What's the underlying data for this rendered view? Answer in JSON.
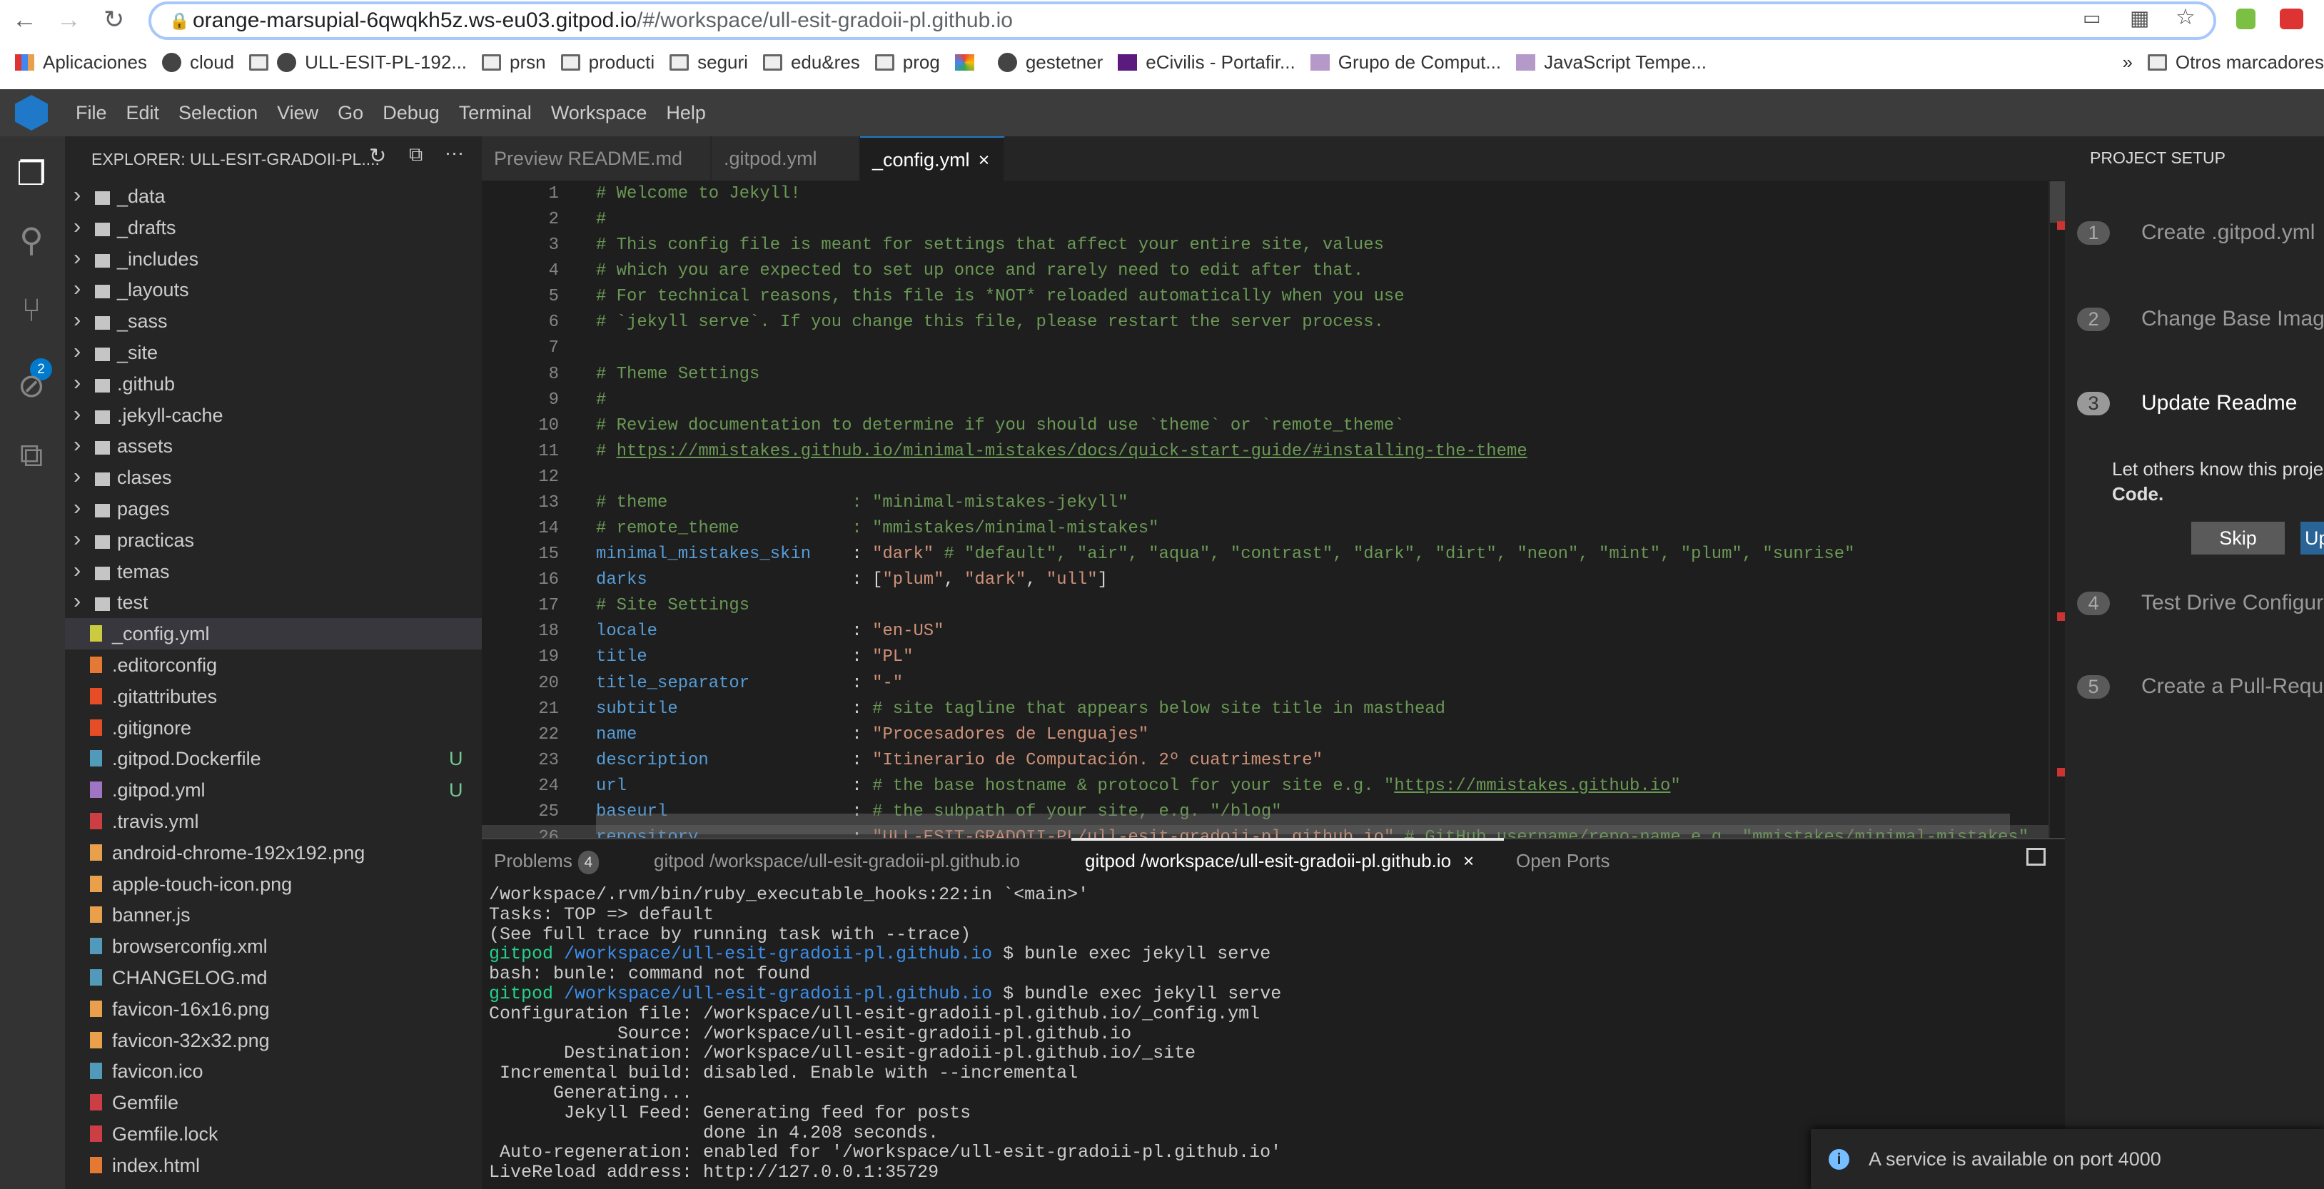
{
  "browser": {
    "url_host": "orange-marsupial-6qwqkh5z.ws-eu03.gitpod.io",
    "url_path": "/#/workspace/ull-esit-gradoii-pl.github.io",
    "bookmarks": [
      "Aplicaciones",
      "cloud",
      "ULL-ESIT-PL-192...",
      "prsn",
      "producti",
      "seguri",
      "edu&res",
      "prog",
      "",
      "gestetner",
      "eCivilis - Portafir...",
      "Grupo de Comput...",
      "JavaScript Tempe..."
    ],
    "bookmark_icons": [
      "apps-icon",
      "globe-icon",
      "folder-icon",
      "github-icon",
      "folder-icon",
      "folder-icon",
      "folder-icon",
      "folder-icon",
      "folder-icon",
      "pinwheel-icon",
      "globe-icon",
      "ecivilis-icon",
      "ull-icon",
      "ull-icon"
    ],
    "more": "»",
    "other_bookmarks": "Otros marcadores"
  },
  "menu": [
    "File",
    "Edit",
    "Selection",
    "View",
    "Go",
    "Debug",
    "Terminal",
    "Workspace",
    "Help"
  ],
  "scm_badge": "2",
  "explorer": {
    "title": "EXPLORER: ULL-ESIT-GRADOII-PL....",
    "items": [
      {
        "n": "_data",
        "f": 1
      },
      {
        "n": "_drafts",
        "f": 1
      },
      {
        "n": "_includes",
        "f": 1
      },
      {
        "n": "_layouts",
        "f": 1
      },
      {
        "n": "_sass",
        "f": 1
      },
      {
        "n": "_site",
        "f": 1
      },
      {
        "n": ".github",
        "f": 1
      },
      {
        "n": ".jekyll-cache",
        "f": 1
      },
      {
        "n": "assets",
        "f": 1
      },
      {
        "n": "clases",
        "f": 1
      },
      {
        "n": "pages",
        "f": 1
      },
      {
        "n": "practicas",
        "f": 1
      },
      {
        "n": "temas",
        "f": 1
      },
      {
        "n": "test",
        "f": 1
      },
      {
        "n": "_config.yml",
        "c": "#cbcb41",
        "sel": 1
      },
      {
        "n": ".editorconfig",
        "c": "#e37933"
      },
      {
        "n": ".gitattributes",
        "c": "#e44d26"
      },
      {
        "n": ".gitignore",
        "c": "#e44d26"
      },
      {
        "n": ".gitpod.Dockerfile",
        "c": "#519aba",
        "g": "U"
      },
      {
        "n": ".gitpod.yml",
        "c": "#a074c4",
        "g": "U"
      },
      {
        "n": ".travis.yml",
        "c": "#cc3e44"
      },
      {
        "n": "android-chrome-192x192.png",
        "c": "#e8a04c"
      },
      {
        "n": "apple-touch-icon.png",
        "c": "#e8a04c"
      },
      {
        "n": "banner.js",
        "c": "#e8a04c"
      },
      {
        "n": "browserconfig.xml",
        "c": "#519aba"
      },
      {
        "n": "CHANGELOG.md",
        "c": "#519aba"
      },
      {
        "n": "favicon-16x16.png",
        "c": "#e8a04c"
      },
      {
        "n": "favicon-32x32.png",
        "c": "#e8a04c"
      },
      {
        "n": "favicon.ico",
        "c": "#519aba"
      },
      {
        "n": "Gemfile",
        "c": "#cc3e44"
      },
      {
        "n": "Gemfile.lock",
        "c": "#cc3e44"
      },
      {
        "n": "index.html",
        "c": "#e37933"
      }
    ]
  },
  "tabs": [
    {
      "label": "Preview README.md"
    },
    {
      "label": ".gitpod.yml"
    },
    {
      "label": "_config.yml",
      "close": "×"
    }
  ],
  "code": [
    [
      [
        "c",
        "# Welcome to Jekyll!"
      ]
    ],
    [
      [
        "c",
        "#"
      ]
    ],
    [
      [
        "c",
        "# This config file is meant for settings that affect your entire site, values"
      ]
    ],
    [
      [
        "c",
        "# which you are expected to set up once and rarely need to edit after that."
      ]
    ],
    [
      [
        "c",
        "# For technical reasons, this file is *NOT* reloaded automatically when you use"
      ]
    ],
    [
      [
        "c",
        "# `jekyll serve`. If you change this file, please restart the server process."
      ]
    ],
    [],
    [
      [
        "c",
        "# Theme Settings"
      ]
    ],
    [
      [
        "c",
        "#"
      ]
    ],
    [
      [
        "c",
        "# Review documentation to determine if you should use `theme` or `remote_theme`"
      ]
    ],
    [
      [
        "c",
        "# "
      ],
      [
        "u",
        "https://mmistakes.github.io/minimal-mistakes/docs/quick-start-guide/#installing-the-theme"
      ]
    ],
    [],
    [
      [
        "c",
        "# theme                  : \"minimal-mistakes-jekyll\""
      ]
    ],
    [
      [
        "c",
        "# remote_theme           : \"mmistakes/minimal-mistakes\""
      ]
    ],
    [
      [
        "k",
        "minimal_mistakes_skin"
      ],
      [
        "p",
        "    : "
      ],
      [
        "s",
        "\"dark\""
      ],
      [
        "c",
        " # \"default\", \"air\", \"aqua\", \"contrast\", \"dark\", \"dirt\", \"neon\", \"mint\", \"plum\", \"sunrise\""
      ]
    ],
    [
      [
        "k",
        "darks"
      ],
      [
        "p",
        "                    : "
      ],
      [
        "p",
        "["
      ],
      [
        "s",
        "\"plum\""
      ],
      [
        "p",
        ", "
      ],
      [
        "s",
        "\"dark\""
      ],
      [
        "p",
        ", "
      ],
      [
        "s",
        "\"ull\""
      ],
      [
        "p",
        "]"
      ]
    ],
    [
      [
        "c",
        "# Site Settings"
      ]
    ],
    [
      [
        "k",
        "locale"
      ],
      [
        "p",
        "                   : "
      ],
      [
        "s",
        "\"en-US\""
      ]
    ],
    [
      [
        "k",
        "title"
      ],
      [
        "p",
        "                    : "
      ],
      [
        "s",
        "\"PL\""
      ]
    ],
    [
      [
        "k",
        "title_separator"
      ],
      [
        "p",
        "          : "
      ],
      [
        "s",
        "\"-\""
      ]
    ],
    [
      [
        "k",
        "subtitle"
      ],
      [
        "p",
        "                 : "
      ],
      [
        "c",
        "# site tagline that appears below site title in masthead"
      ]
    ],
    [
      [
        "k",
        "name"
      ],
      [
        "p",
        "                     : "
      ],
      [
        "s",
        "\"Procesadores de Lenguajes\""
      ]
    ],
    [
      [
        "k",
        "description"
      ],
      [
        "p",
        "              : "
      ],
      [
        "s",
        "\"Itinerario de Computación. 2º cuatrimestre\""
      ]
    ],
    [
      [
        "k",
        "url"
      ],
      [
        "p",
        "                      : "
      ],
      [
        "c",
        "# the base hostname & protocol for your site e.g. \""
      ],
      [
        "u",
        "https://mmistakes.github.io"
      ],
      [
        "c",
        "\""
      ]
    ],
    [
      [
        "k",
        "baseurl"
      ],
      [
        "p",
        "                  : "
      ],
      [
        "c",
        "# the subpath of your site, e.g. \"/blog\""
      ]
    ],
    [
      [
        "k",
        "repository"
      ],
      [
        "p",
        "               : "
      ],
      [
        "s",
        "\"ULL-ESIT-GRADOII-PL/ull-esit-gradoii-pl.github.io\""
      ],
      [
        "c",
        " # GitHub username/repo-name e.g. \"mmistakes/minimal-mistakes\""
      ]
    ]
  ],
  "panel": {
    "problems": "Problems",
    "problems_count": "4",
    "term1": "gitpod /workspace/ull-esit-gradoii-pl.github.io",
    "term2": "gitpod /workspace/ull-esit-gradoii-pl.github.io",
    "term2_close": "×",
    "ports": "Open Ports"
  },
  "terminal": [
    [
      [
        "",
        "/workspace/.rvm/bin/ruby_executable_hooks:22:in `<main>'"
      ]
    ],
    [
      [
        "",
        "Tasks: TOP => default"
      ]
    ],
    [
      [
        "",
        "(See full trace by running task with --trace)"
      ]
    ],
    [
      [
        "tg",
        "gitpod "
      ],
      [
        "tb",
        "/workspace/ull-esit-gradoii-pl.github.io"
      ],
      [
        "",
        " $ bunle exec jekyll serve"
      ]
    ],
    [
      [
        "",
        "bash: bunle: command not found"
      ]
    ],
    [
      [
        "tg",
        "gitpod "
      ],
      [
        "tb",
        "/workspace/ull-esit-gradoii-pl.github.io"
      ],
      [
        "",
        " $ bundle exec jekyll serve"
      ]
    ],
    [
      [
        "",
        "Configuration file: /workspace/ull-esit-gradoii-pl.github.io/_config.yml"
      ]
    ],
    [
      [
        "",
        "            Source: /workspace/ull-esit-gradoii-pl.github.io"
      ]
    ],
    [
      [
        "",
        "       Destination: /workspace/ull-esit-gradoii-pl.github.io/_site"
      ]
    ],
    [
      [
        "",
        " Incremental build: disabled. Enable with --incremental"
      ]
    ],
    [
      [
        "",
        "      Generating..."
      ]
    ],
    [
      [
        "",
        "       Jekyll Feed: Generating feed for posts"
      ]
    ],
    [
      [
        "",
        "                    done in 4.208 seconds."
      ]
    ],
    [
      [
        "",
        " Auto-regeneration: enabled for '/workspace/ull-esit-gradoii-pl.github.io'"
      ]
    ],
    [
      [
        "",
        "LiveReload address: http://127.0.0.1:35729"
      ]
    ]
  ],
  "setup": {
    "title": "PROJECT SETUP",
    "steps": [
      {
        "n": "1",
        "t": "Create .gitpod.yml"
      },
      {
        "n": "2",
        "t": "Change Base Image"
      },
      {
        "n": "3",
        "t": "Update Readme",
        "active": 1
      },
      {
        "n": "4",
        "t": "Test Drive Configuration"
      },
      {
        "n": "5",
        "t": "Create a Pull-Request"
      }
    ],
    "desc": "Let others know this project",
    "desc_bold": "Code.",
    "skip": "Skip",
    "update": "Update"
  },
  "notification": "A service is available on port 4000",
  "colors": {
    "accent": "#007acc",
    "git_untracked": "#73c991"
  }
}
